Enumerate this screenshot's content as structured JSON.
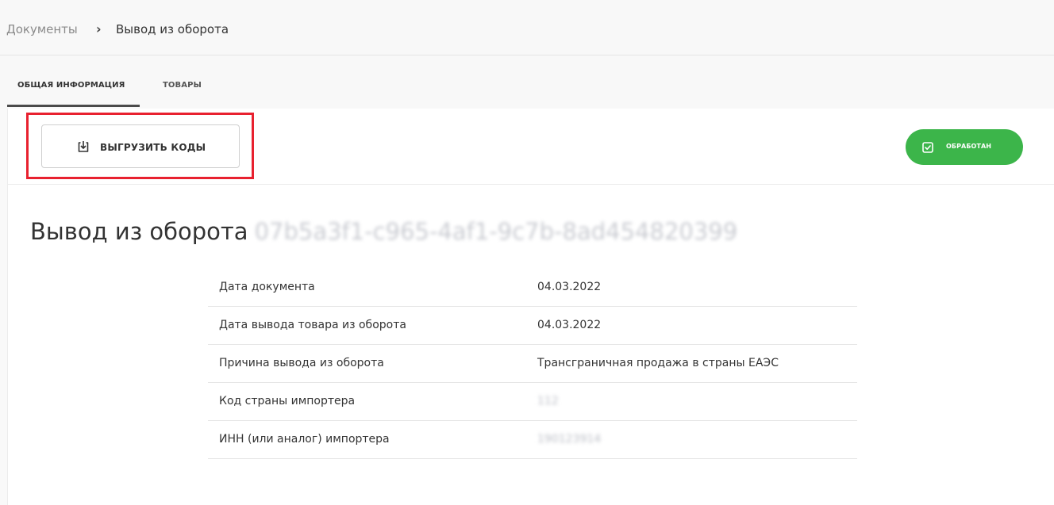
{
  "breadcrumb": {
    "root": "Документы",
    "separator": "›",
    "current": "Вывод из оборота"
  },
  "tabs": [
    {
      "label": "ОБЩАЯ ИНФОРМАЦИЯ",
      "active": true
    },
    {
      "label": "ТОВАРЫ",
      "active": false
    }
  ],
  "toolbar": {
    "download_label": "ВЫГРУЗИТЬ КОДЫ",
    "download_icon": "download-icon",
    "status_label": "ОБРАБОТАН",
    "status_icon": "check-square-icon",
    "status_color": "#3cb54a",
    "highlight_color": "#e8212f"
  },
  "document": {
    "title": "Вывод из оборота",
    "id_blurred": "07b5a3f1-c965-4af1-9c7b-8ad454820399"
  },
  "details": [
    {
      "key": "Дата документа",
      "value": "04.03.2022",
      "blurred": false
    },
    {
      "key": "Дата вывода товара из оборота",
      "value": "04.03.2022",
      "blurred": false
    },
    {
      "key": "Причина вывода из оборота",
      "value": "Трансграничная продажа в страны ЕАЭС",
      "blurred": false
    },
    {
      "key": "Код страны импортера",
      "value": "112",
      "blurred": true
    },
    {
      "key": "ИНН (или аналог) импортера",
      "value": "190123914",
      "blurred": true
    }
  ]
}
